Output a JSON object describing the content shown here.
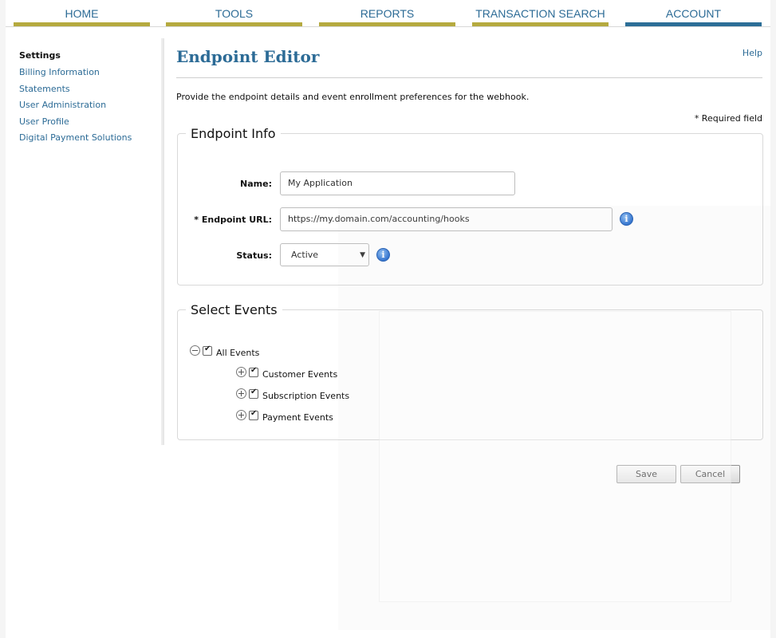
{
  "nav": {
    "tabs": [
      {
        "label": "HOME",
        "active": false
      },
      {
        "label": "TOOLS",
        "active": false
      },
      {
        "label": "REPORTS",
        "active": false
      },
      {
        "label": "TRANSACTION SEARCH",
        "active": false
      },
      {
        "label": "ACCOUNT",
        "active": true
      }
    ],
    "colors": {
      "tab_bar": "#b5aa3f",
      "active_bar": "#2c6e97",
      "link": "#2c6b96"
    }
  },
  "sidebar": {
    "title": "Settings",
    "items": [
      "Billing Information",
      "Statements",
      "User Administration",
      "User Profile",
      "Digital Payment Solutions"
    ]
  },
  "main": {
    "title": "Endpoint Editor",
    "help": "Help",
    "description": "Provide the endpoint details and event enrollment preferences for the webhook.",
    "required_note": "* Required field",
    "endpoint_info": {
      "legend": "Endpoint Info",
      "name_label": "Name:",
      "name_value": "My Application",
      "url_label": "* Endpoint URL:",
      "url_value": "https://my.domain.com/accounting/hooks",
      "status_label": "Status:",
      "status_value": "Active",
      "info_icon": "i"
    },
    "select_events": {
      "legend": "Select Events",
      "root": {
        "label": "All Events",
        "checked": true,
        "expanded": true
      },
      "children": [
        {
          "label": "Customer Events",
          "checked": true,
          "expanded": false
        },
        {
          "label": "Subscription Events",
          "checked": true,
          "expanded": false
        },
        {
          "label": "Payment Events",
          "checked": true,
          "expanded": false
        }
      ]
    },
    "buttons": {
      "save": "Save",
      "cancel": "Cancel"
    }
  }
}
